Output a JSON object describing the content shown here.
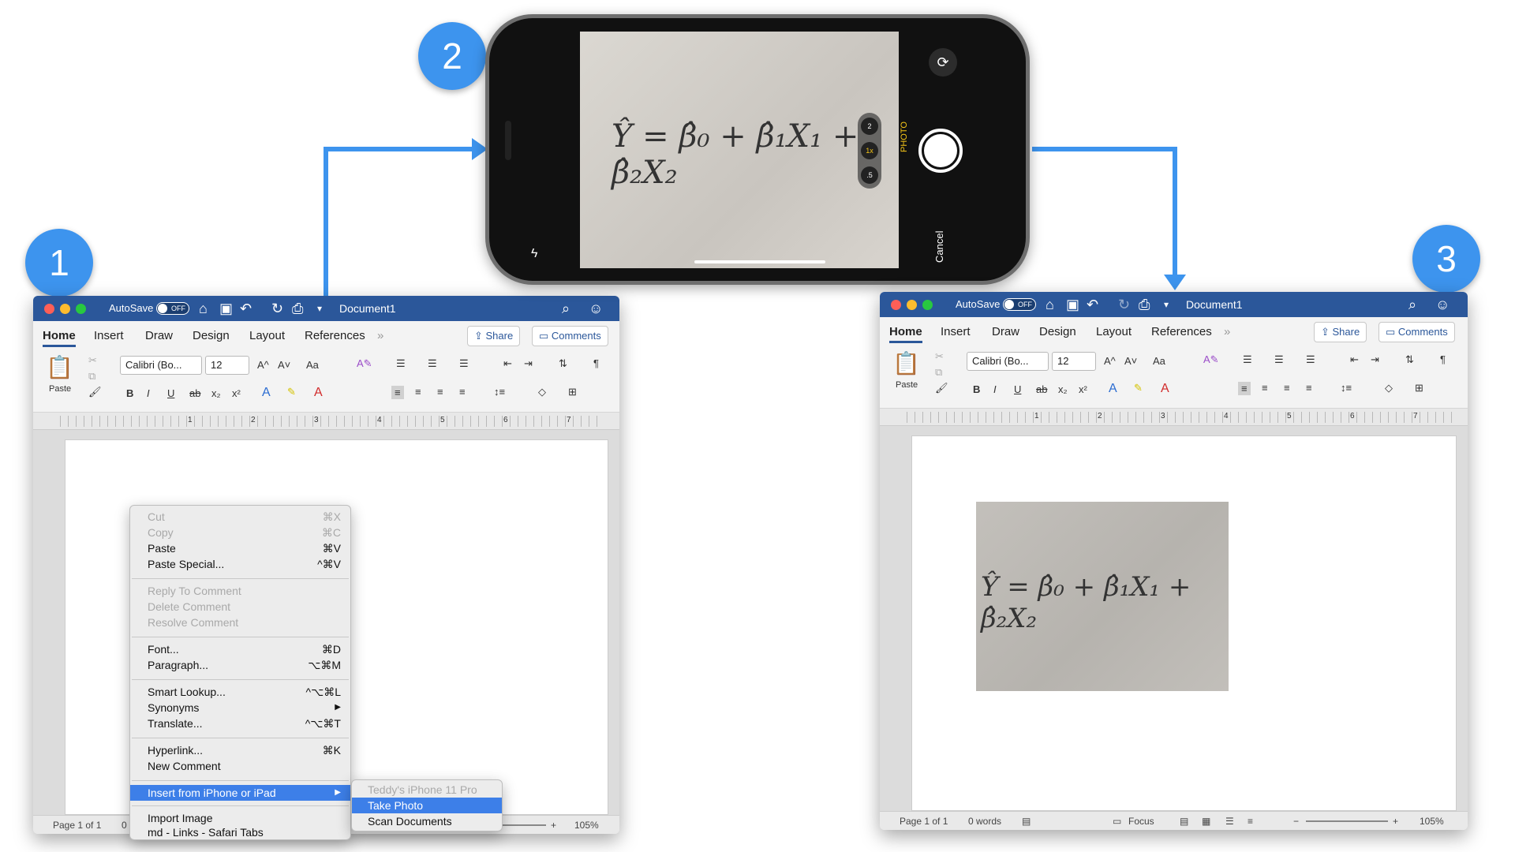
{
  "steps": {
    "one": "1",
    "two": "2",
    "three": "3"
  },
  "colors": {
    "accent": "#3d94ee",
    "titlebar": "#2b579a",
    "menu_selected": "#3d7fe8"
  },
  "word": {
    "autosave": "AutoSave",
    "toggle_off": "OFF",
    "doc_title": "Document1",
    "tabs": [
      "Home",
      "Insert",
      "Draw",
      "Design",
      "Layout",
      "References"
    ],
    "more_tabs": "»",
    "share": "Share",
    "comments": "Comments",
    "paste": "Paste",
    "font_name": "Calibri (Bo...",
    "font_size": "12",
    "grow_font": "A^",
    "shrink_font": "A˅",
    "change_case": "Aa",
    "bold": "B",
    "italic": "I",
    "underline": "U",
    "strike": "ab",
    "subscript": "x₂",
    "superscript": "x²",
    "pilcrow": "¶",
    "ruler_numbers": [
      "1",
      "2",
      "3",
      "4",
      "5",
      "6",
      "7"
    ],
    "left_status": {
      "page": "Page 1 of 1",
      "words_partial": "0",
      "zoom": "105%",
      "plus": "+"
    },
    "right_status": {
      "page": "Page 1 of 1",
      "words": "0 words",
      "focus": "Focus",
      "zoom": "105%",
      "minus": "−",
      "plus": "+"
    }
  },
  "context_menu": {
    "items": [
      {
        "label": "Cut",
        "shortcut": "⌘X",
        "disabled": true
      },
      {
        "label": "Copy",
        "shortcut": "⌘C",
        "disabled": true
      },
      {
        "label": "Paste",
        "shortcut": "⌘V",
        "disabled": false
      },
      {
        "label": "Paste Special...",
        "shortcut": "^⌘V",
        "disabled": false
      },
      {
        "label": "Reply To Comment",
        "shortcut": "",
        "disabled": true
      },
      {
        "label": "Delete Comment",
        "shortcut": "",
        "disabled": true
      },
      {
        "label": "Resolve Comment",
        "shortcut": "",
        "disabled": true
      },
      {
        "label": "Font...",
        "shortcut": "⌘D",
        "disabled": false
      },
      {
        "label": "Paragraph...",
        "shortcut": "⌥⌘M",
        "disabled": false
      },
      {
        "label": "Smart Lookup...",
        "shortcut": "^⌥⌘L",
        "disabled": false
      },
      {
        "label": "Synonyms",
        "shortcut": "▶",
        "disabled": false
      },
      {
        "label": "Translate...",
        "shortcut": "^⌥⌘T",
        "disabled": false
      },
      {
        "label": "Hyperlink...",
        "shortcut": "⌘K",
        "disabled": false
      },
      {
        "label": "New Comment",
        "shortcut": "",
        "disabled": false
      },
      {
        "label": "Insert from iPhone or iPad",
        "shortcut": "▶",
        "disabled": false
      },
      {
        "label": "Import Image",
        "shortcut": "",
        "disabled": false
      },
      {
        "label": "md - Links - Safari Tabs",
        "shortcut": "",
        "disabled": false
      }
    ],
    "submenu": {
      "device": "Teddy's iPhone 11 Pro",
      "take_photo": "Take Photo",
      "scan_documents": "Scan Documents"
    }
  },
  "camera": {
    "zoom_options": [
      "2",
      "1x",
      ".5"
    ],
    "mode": "PHOTO",
    "cancel": "Cancel",
    "formula_text": "Ŷ = β̂₀ + β̂₁X₁ + β̂₂X₂"
  }
}
